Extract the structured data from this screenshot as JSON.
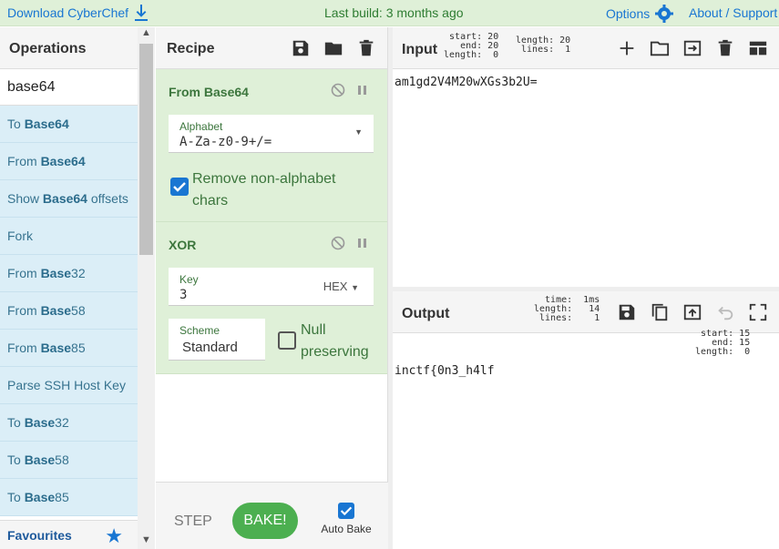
{
  "banner": {
    "download_label": "Download CyberChef",
    "build_label": "Last build: 3 months ago",
    "options_label": "Options",
    "about_label": "About / Support"
  },
  "operations": {
    "title": "Operations",
    "search_value": "base64",
    "items": [
      {
        "pre": "To ",
        "bold": "Base64",
        "post": ""
      },
      {
        "pre": "From ",
        "bold": "Base64",
        "post": ""
      },
      {
        "pre": "Show ",
        "bold": "Base64",
        "post": " offsets"
      },
      {
        "pre": "Fork",
        "bold": "",
        "post": ""
      },
      {
        "pre": "From ",
        "bold": "Base",
        "post": "32"
      },
      {
        "pre": "From ",
        "bold": "Base",
        "post": "58"
      },
      {
        "pre": "From ",
        "bold": "Base",
        "post": "85"
      },
      {
        "pre": "Parse SSH Host Key",
        "bold": "",
        "post": ""
      },
      {
        "pre": "To ",
        "bold": "Base",
        "post": "32"
      },
      {
        "pre": "To ",
        "bold": "Base",
        "post": "58"
      },
      {
        "pre": "To ",
        "bold": "Base",
        "post": "85"
      }
    ],
    "favourites_label": "Favourites"
  },
  "recipe": {
    "title": "Recipe",
    "from_base64": {
      "title": "From Base64",
      "alphabet_label": "Alphabet",
      "alphabet_value": "A-Za-z0-9+/=",
      "remove_label_1": "Remove non-alphabet",
      "remove_label_2": "chars",
      "remove_checked": true
    },
    "xor": {
      "title": "XOR",
      "key_label": "Key",
      "key_value": "3",
      "key_format": "HEX",
      "scheme_label": "Scheme",
      "scheme_value": "Standard",
      "null_label_1": "Null",
      "null_label_2": "preserving",
      "null_checked": false
    },
    "step_label": "STEP",
    "bake_label": "BAKE!",
    "autobake_label": "Auto Bake",
    "autobake_checked": true
  },
  "input": {
    "title": "Input",
    "stats_left": "start: 20\n  end: 20\nlength:  0",
    "stats_right": "length: 20\n lines:  1",
    "text": "am1gd2V4M20wXGs3b2U="
  },
  "output": {
    "title": "Output",
    "stats": "  time:  1ms\nlength:   14\n lines:    1",
    "sel_stats": "start: 15\n  end: 15\nlength:  0",
    "text": "inctf{0n3_h4lf"
  },
  "colors": {
    "accent": "#1976d2",
    "op_green": "#dff0d8",
    "op_list_blue": "#dbeef7",
    "bake_green": "#4caf50"
  }
}
